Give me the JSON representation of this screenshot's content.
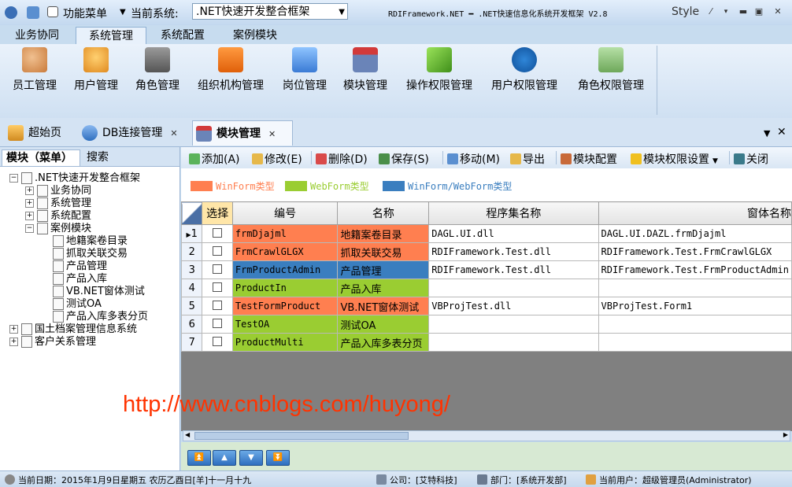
{
  "titlebar": {
    "menu_label": "功能菜单",
    "current_system_label": "当前系统:",
    "system_selected": ".NET快速开发整合框架",
    "app_title": "RDIFramework.NET ━ .NET快速信息化系统开发框架 V2.8",
    "style_label": "Style"
  },
  "ribbon_tabs": [
    "业务协同",
    "系统管理",
    "系统配置",
    "案例模块"
  ],
  "ribbon_buttons": [
    "员工管理",
    "用户管理",
    "角色管理",
    "组织机构管理",
    "岗位管理",
    "模块管理",
    "操作权限管理",
    "用户权限管理",
    "角色权限管理"
  ],
  "doc_tabs": [
    "超始页",
    "DB连接管理",
    "模块管理"
  ],
  "left_tabs": [
    "模块（菜单）",
    "搜索"
  ],
  "tree": {
    "root": ".NET快速开发整合框架",
    "groups": [
      "业务协同",
      "系统管理",
      "系统配置",
      "案例模块"
    ],
    "case_children": [
      "地籍案卷目录",
      "抓取关联交易",
      "产品管理",
      "产品入库",
      "VB.NET窗体测试",
      "测试OA",
      "产品入库多表分页"
    ],
    "others": [
      "国土档案管理信息系统",
      "客户关系管理"
    ]
  },
  "toolbar": [
    "添加(A)",
    "修改(E)",
    "删除(D)",
    "保存(S)",
    "移动(M)",
    "导出",
    "模块配置",
    "模块权限设置",
    "关闭"
  ],
  "legend": [
    "WinForm类型",
    "WebForm类型",
    "WinForm/WebForm类型"
  ],
  "colors": {
    "winform": "#ff7f50",
    "webform": "#9acd32",
    "both": "#3a7ebf"
  },
  "grid": {
    "headers": [
      "选择",
      "编号",
      "名称",
      "程序集名称",
      "窗体名称"
    ],
    "rows": [
      {
        "num": "1",
        "code": "frmDjajml",
        "name": "地籍案卷目录",
        "assembly": "DAGL.UI.dll",
        "form": "DAGL.UI.DAZL.frmDjajml",
        "type": "winform"
      },
      {
        "num": "2",
        "code": "FrmCrawlGLGX",
        "name": "抓取关联交易",
        "assembly": "RDIFramework.Test.dll",
        "form": "RDIFramework.Test.FrmCrawlGLGX",
        "type": "winform"
      },
      {
        "num": "3",
        "code": "FrmProductAdmin",
        "name": "产品管理",
        "assembly": "RDIFramework.Test.dll",
        "form": "RDIFramework.Test.FrmProductAdmin",
        "type": "both"
      },
      {
        "num": "4",
        "code": "ProductIn",
        "name": "产品入库",
        "assembly": "",
        "form": "",
        "type": "webform"
      },
      {
        "num": "5",
        "code": "TestFormProduct",
        "name": "VB.NET窗体测试",
        "assembly": "VBProjTest.dll",
        "form": "VBProjTest.Form1",
        "type": "winform"
      },
      {
        "num": "6",
        "code": "TestOA",
        "name": "测试OA",
        "assembly": "",
        "form": "",
        "type": "webform"
      },
      {
        "num": "7",
        "code": "ProductMulti",
        "name": "产品入库多表分页",
        "assembly": "",
        "form": "",
        "type": "webform"
      }
    ]
  },
  "watermark": "http://www.cnblogs.com/huyong/",
  "status": {
    "date": "当前日期：2015年1月9日星期五 农历乙酉日[羊]十一月十九",
    "company": "公司：[艾特科技]",
    "dept": "部门：[系统开发部]",
    "user": "当前用户：超级管理员(Administrator)"
  }
}
